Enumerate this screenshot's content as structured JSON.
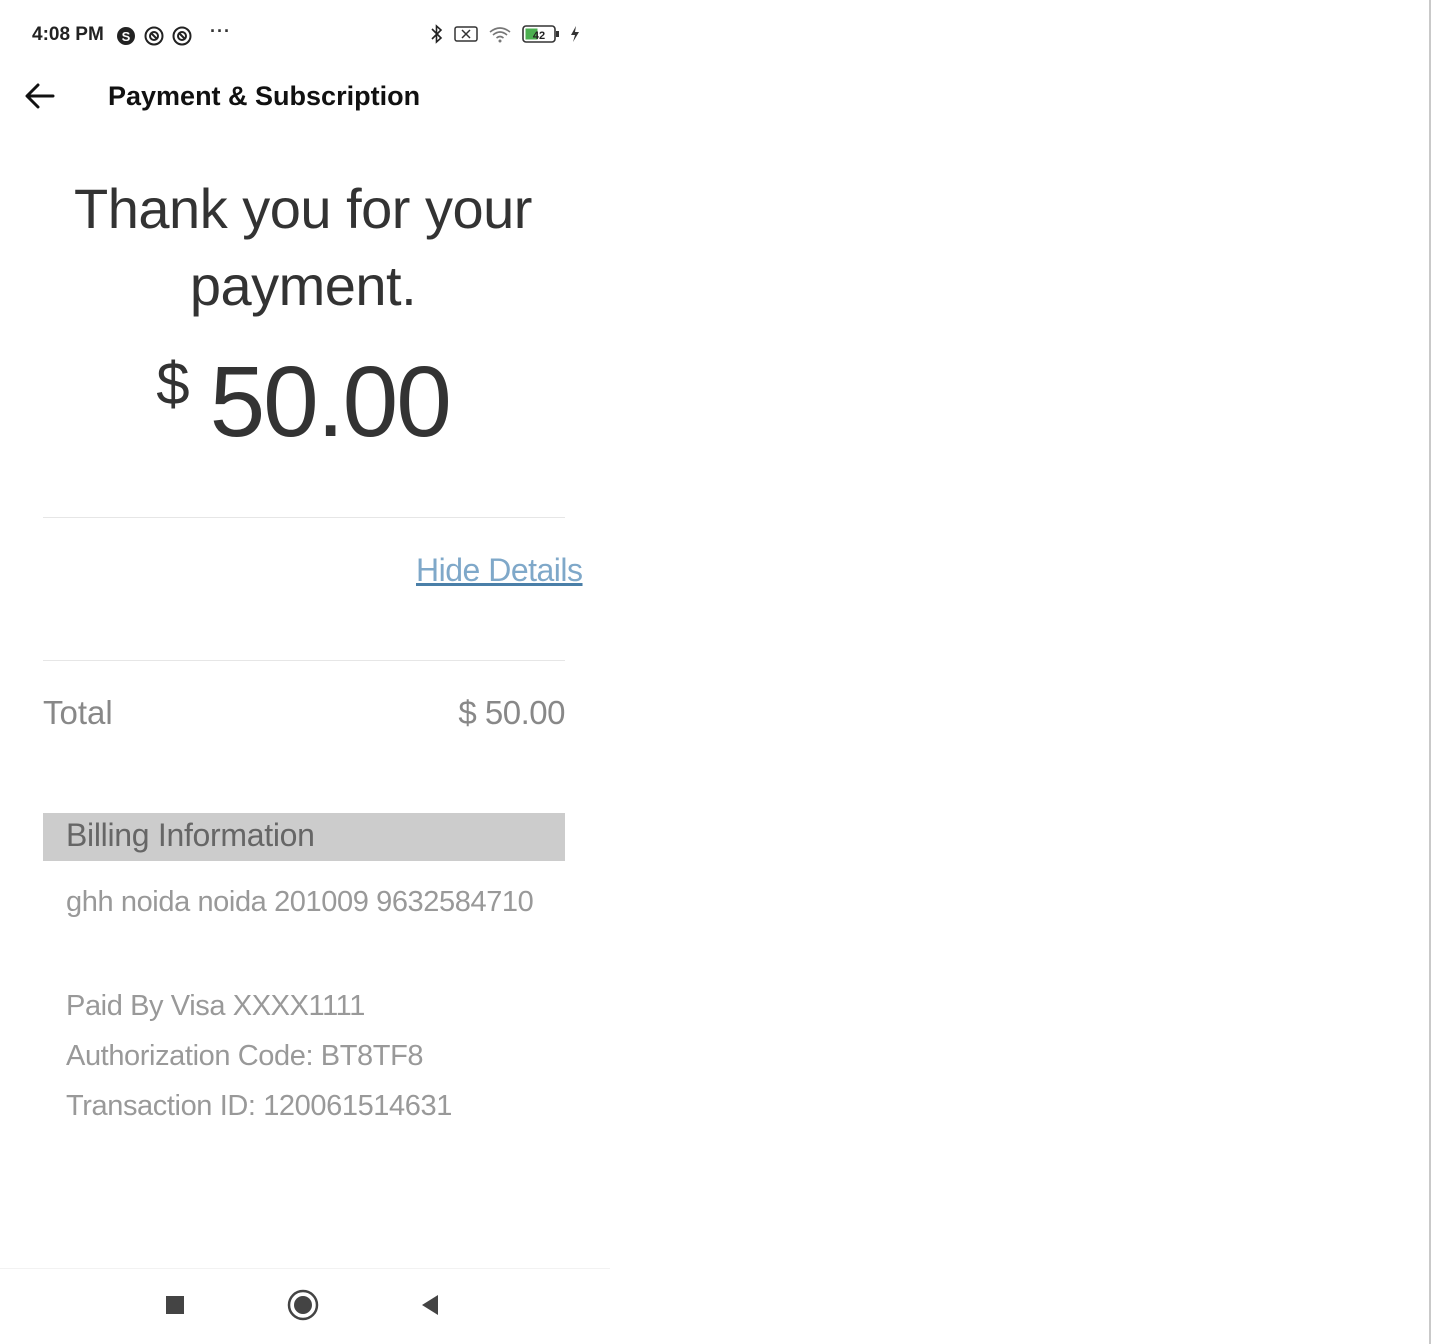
{
  "status_bar": {
    "time": "4:08 PM",
    "overflow": "···",
    "battery": "42",
    "icons": [
      "skype-icon",
      "sync-icon",
      "sync-icon",
      "bluetooth-icon",
      "sim-off-icon",
      "wifi-icon",
      "battery-icon",
      "charging-icon"
    ]
  },
  "app_bar": {
    "title": "Payment & Subscription",
    "back_icon": "arrow-left-icon"
  },
  "receipt": {
    "thanks_line1": "Thank you for your",
    "thanks_line2": "payment.",
    "currency": "$",
    "amount": "50.00",
    "hide_details": "Hide Details",
    "total_label": "Total",
    "total_value": "$ 50.00"
  },
  "billing": {
    "header": "Billing Information",
    "address": "ghh noida noida 201009 9632584710",
    "paid_by": "Paid By Visa XXXX1111",
    "authorization": "Authorization Code: BT8TF8",
    "transaction": "Transaction ID: 120061514631"
  },
  "nav_bar": {
    "icons": [
      "recents-icon",
      "home-icon",
      "back-icon"
    ]
  },
  "colors": {
    "link": "#7fa8c9",
    "billing_header_bg": "#cccccc",
    "muted_text": "#999999"
  }
}
